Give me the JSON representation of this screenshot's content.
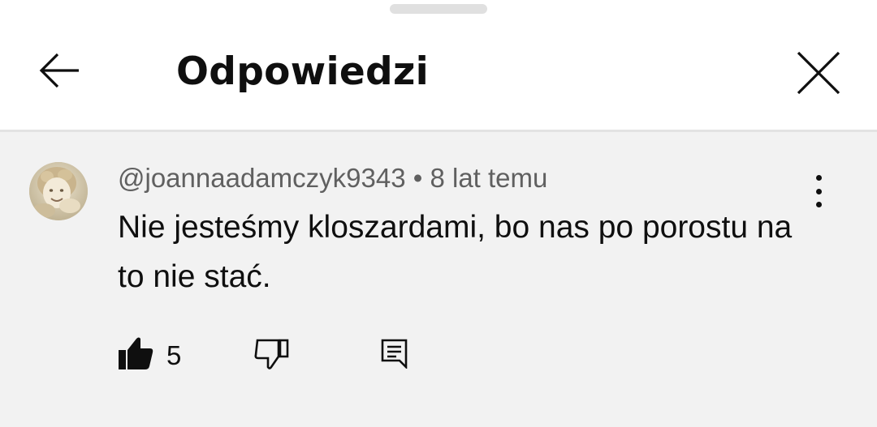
{
  "sheet": {
    "title": "Odpowiedzi"
  },
  "icons": {
    "back": "arrow-left-icon",
    "close": "close-icon",
    "more": "more-vertical-icon",
    "like": "thumb-up-filled-icon",
    "dislike": "thumb-down-outline-icon",
    "reply": "comment-reply-icon"
  },
  "comment": {
    "author": "@joannaadamczyk9343",
    "separator": "•",
    "time": "8 lat temu",
    "text": "Nie jesteśmy kloszardami, bo nas po porostu na to nie stać.",
    "likes": "5"
  },
  "colors": {
    "sheet_background": "#ffffff",
    "comment_background": "#f2f2f2",
    "primary_text": "#0f0f0f",
    "secondary_text": "#606060"
  }
}
